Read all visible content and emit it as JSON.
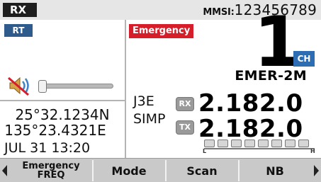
{
  "topbar": {
    "status": "RX",
    "mmsi_label": "MMSI:",
    "mmsi_value": "123456789"
  },
  "left_pane": {
    "rt_badge": "RT",
    "volume_icon": "speaker-muted-icon",
    "latitude": "25°32.1234N",
    "longitude": "135°23.4321E",
    "datetime": "JUL 31 13:20"
  },
  "right_pane": {
    "emergency_tag": "Emergency",
    "channel_number": "1",
    "channel_badge": "CH",
    "channel_name": "EMER-2M",
    "mode_line1": "J3E",
    "mode_line2": "SIMP",
    "rx_label": "RX",
    "tx_label": "TX",
    "rx_freq": "2.182.0",
    "tx_freq": "2.182.0",
    "meter_low": "L",
    "meter_high": "H"
  },
  "softkeys": {
    "key1_line1": "Emergency",
    "key1_line2": "FREQ",
    "key2": "Mode",
    "key3": "Scan",
    "key4": "NB"
  },
  "colors": {
    "emergency": "#d51e2a",
    "rt_badge": "#2f5b8c",
    "ch_badge": "#2d6db3",
    "softkey_bg": "#c9c9c9"
  }
}
